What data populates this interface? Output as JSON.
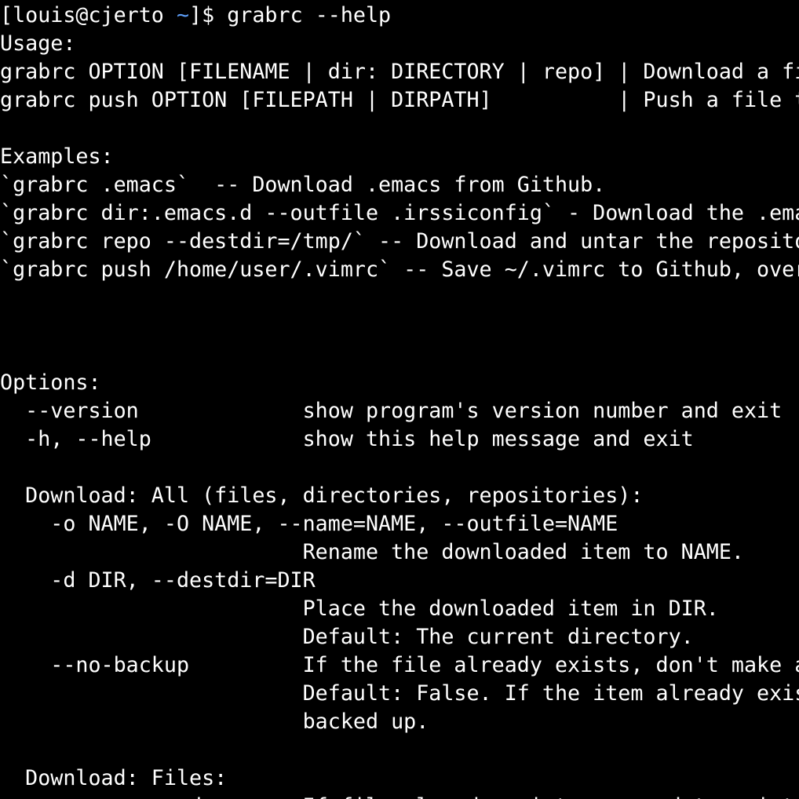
{
  "colors": {
    "background": "#000000",
    "foreground": "#ffffff",
    "prompt_path": "#5c9cf5"
  },
  "prompt": {
    "prefix": "[louis@cjerto ",
    "path": "~",
    "suffix": "]$ ",
    "command": "grabrc --help"
  },
  "lines": [
    "Usage:",
    "grabrc OPTION [FILENAME | dir: DIRECTORY | repo] | Download a fi",
    "grabrc push OPTION [FILEPATH | DIRPATH]          | Push a file t",
    "",
    "Examples:",
    "`grabrc .emacs`  -- Download .emacs from Github.",
    "`grabrc dir:.emacs.d --outfile .irssiconfig` - Download the .ema",
    "`grabrc repo --destdir=/tmp/` -- Download and untar the reposito",
    "`grabrc push /home/user/.vimrc` -- Save ~/.vimrc to Github, over",
    "",
    "",
    "",
    "Options:",
    "  --version             show program's version number and exit",
    "  -h, --help            show this help message and exit",
    "",
    "  Download: All (files, directories, repositories):",
    "    -o NAME, -O NAME, --name=NAME, --outfile=NAME",
    "                        Rename the downloaded item to NAME.",
    "    -d DIR, --destdir=DIR",
    "                        Place the downloaded item in DIR.",
    "                        Default: The current directory.",
    "    --no-backup         If the file already exists, don't make a",
    "                        Default: False. If the item already exis",
    "                        backed up.",
    "",
    "  Download: Files:",
    "    -a, --append        If file already exists, append to existi"
  ]
}
